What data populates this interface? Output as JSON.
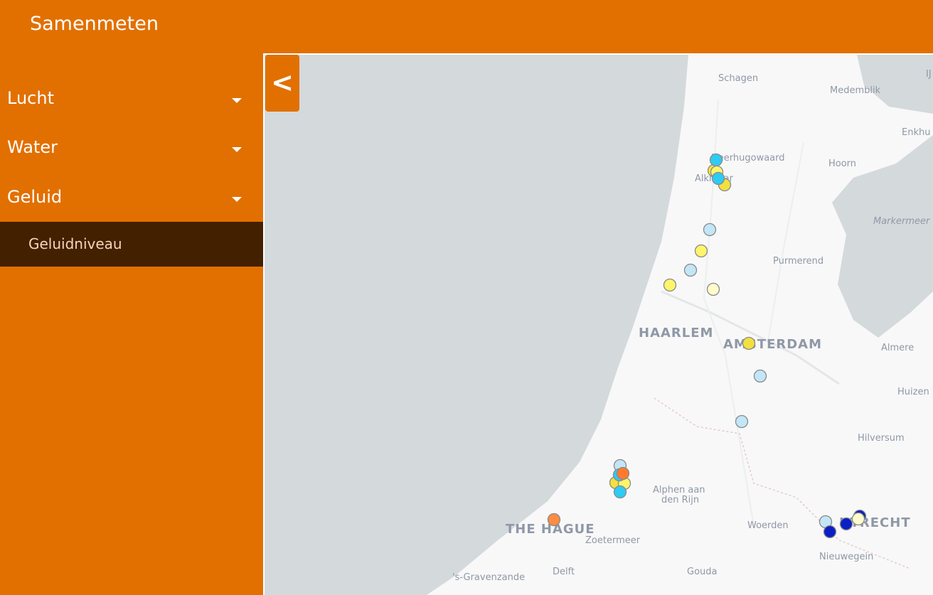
{
  "header": {
    "title": "Samenmeten"
  },
  "sidebar": {
    "items": [
      {
        "label": "Lucht",
        "icon": "caret-down-icon"
      },
      {
        "label": "Water",
        "icon": "caret-down-icon"
      },
      {
        "label": "Geluid",
        "icon": "caret-down-icon"
      }
    ],
    "active_subitem": "Geluidniveau"
  },
  "map": {
    "toggle_label": "<",
    "colors": {
      "land": "#f8f8f8",
      "water": "#d4d9dc",
      "panel": "#e27000",
      "panel_active": "#432000"
    },
    "places": [
      "Schagen",
      "Medemblik",
      "Enkhu",
      "Heerhugowaard",
      "Alkmaar",
      "Hoorn",
      "Markermeer",
      "Purmerend",
      "HAARLEM",
      "AMSTERDAM",
      "Almere",
      "Huizen",
      "Hilversum",
      "Alphen aan",
      "den Rijn",
      "THE HAGUE",
      "Zoetermeer",
      "Woerden",
      "UTRECHT",
      "Nieuwegein",
      "Delft",
      "Gouda",
      "'s-Gravenzande",
      "IJ"
    ],
    "marker_colors": [
      "#2ecbf5",
      "#f5e63c",
      "#fff56a",
      "#c3e6f7",
      "#fffccc",
      "#f2e040",
      "#ff7a2e",
      "#ff8c42",
      "#0a1fc4"
    ]
  }
}
